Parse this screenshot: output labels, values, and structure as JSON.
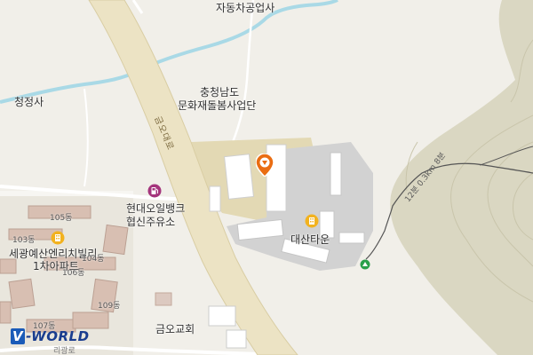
{
  "map": {
    "labels": {
      "repair_shop": "자동차공업사",
      "cheongjeongsa": "청정사",
      "heritage_line1": "충청남도",
      "heritage_line2": "문화재돌봄사업단",
      "road": "금오대로",
      "gas_line1": "현대오일뱅크",
      "gas_line2": "협신주유소",
      "daesan_town": "대산타운",
      "apt_line1": "세광예산엔리치빌리",
      "apt_line2": "1차아파트",
      "church": "금오교회",
      "trail": "12분 0.3km 8분",
      "bottom_road": "리광로"
    },
    "buildings": {
      "b105": "105동",
      "b103": "103동",
      "b104": "104동",
      "b106": "106동",
      "b109": "109동",
      "b107": "107동"
    },
    "icons": {
      "location_pin": "location-pin-icon",
      "gas_station": "gas-station-icon",
      "apartment_daesan": "apartment-icon",
      "apartment_segwang": "apartment-icon",
      "trail_marker": "trail-marker-icon"
    },
    "colors": {
      "background": "#f1efe9",
      "road": "#ece3c4",
      "river": "#a9d9e6",
      "mountain": "#dad7c2",
      "pin": "#ea6d12",
      "poi_yellow": "#f2b21f",
      "gas": "#a4347c"
    }
  },
  "logo": {
    "v": "V",
    "text": "-WORLD"
  }
}
